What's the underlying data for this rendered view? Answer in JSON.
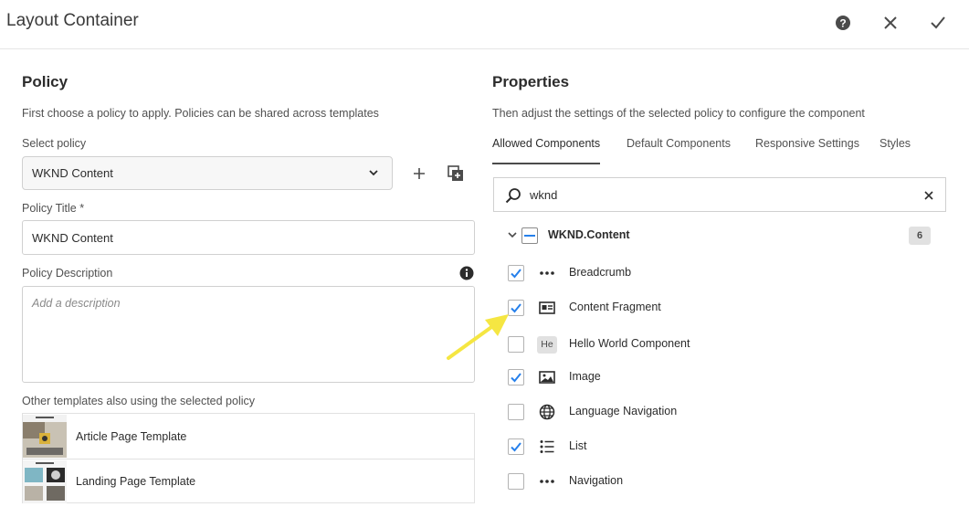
{
  "header": {
    "title": "Layout Container"
  },
  "policy": {
    "heading": "Policy",
    "description": "First choose a policy to apply. Policies can be shared across templates",
    "select_label": "Select policy",
    "select_value": "WKND Content",
    "title_label": "Policy Title *",
    "title_value": "WKND Content",
    "description_label": "Policy Description",
    "description_placeholder": "Add a description",
    "templates_label": "Other templates also using the selected policy",
    "templates": [
      {
        "name": "Article Page Template"
      },
      {
        "name": "Landing Page Template"
      }
    ]
  },
  "properties": {
    "heading": "Properties",
    "description": "Then adjust the settings of the selected policy to configure the component",
    "tabs": [
      {
        "label": "Allowed Components",
        "active": true
      },
      {
        "label": "Default Components",
        "active": false
      },
      {
        "label": "Responsive Settings",
        "active": false
      },
      {
        "label": "Styles",
        "active": false
      }
    ],
    "search_value": "wknd",
    "group": {
      "name": "WKND.Content",
      "count": "6"
    },
    "components": [
      {
        "name": "Breadcrumb",
        "checked": true,
        "icon": "more-icon"
      },
      {
        "name": "Content Fragment",
        "checked": true,
        "icon": "content-fragment-icon"
      },
      {
        "name": "Hello World Component",
        "checked": false,
        "icon": "abbreviation-badge",
        "badge": "He"
      },
      {
        "name": "Image",
        "checked": true,
        "icon": "image-icon"
      },
      {
        "name": "Language Navigation",
        "checked": false,
        "icon": "globe-icon"
      },
      {
        "name": "List",
        "checked": true,
        "icon": "list-icon"
      },
      {
        "name": "Navigation",
        "checked": false,
        "icon": "more-icon"
      }
    ]
  },
  "colors": {
    "accent": "#2680eb",
    "annotation_arrow": "#f5e642"
  }
}
